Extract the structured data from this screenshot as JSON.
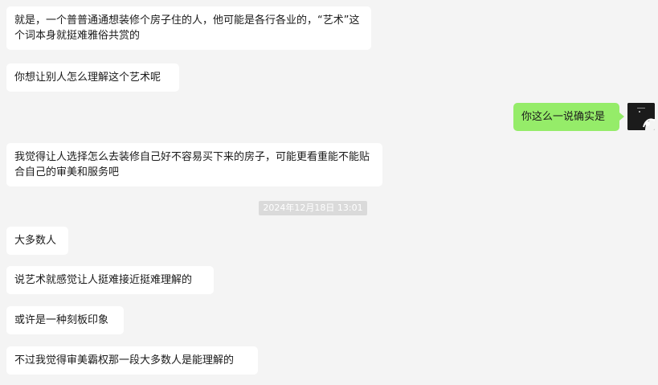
{
  "messages": {
    "m1": "就是，一个普普通通想装修个房子住的人，他可能是各行各业的，“艺术”这个词本身就挺难雅俗共赏的",
    "m2": "你想让别人怎么理解这个艺术呢",
    "m3": "你这么一说确实是",
    "m4": "我觉得让人选择怎么去装修自己好不容易买下来的房子，可能更看重能不能贴合自己的审美和服务吧",
    "timestamp": "2024年12月18日 13:01",
    "m5": "大多数人",
    "m6": "说艺术就感觉让人挺难接近挺难理解的",
    "m7": "或许是一种刻板印象",
    "m8": "不过我觉得审美霸权那一段大多数人是能理解的"
  },
  "colors": {
    "background": "#f4f4f4",
    "incoming_bubble": "#ffffff",
    "outgoing_bubble": "#95ec69",
    "timestamp_bg": "#dadada"
  },
  "icons": {
    "avatar": "user-avatar-icon"
  }
}
